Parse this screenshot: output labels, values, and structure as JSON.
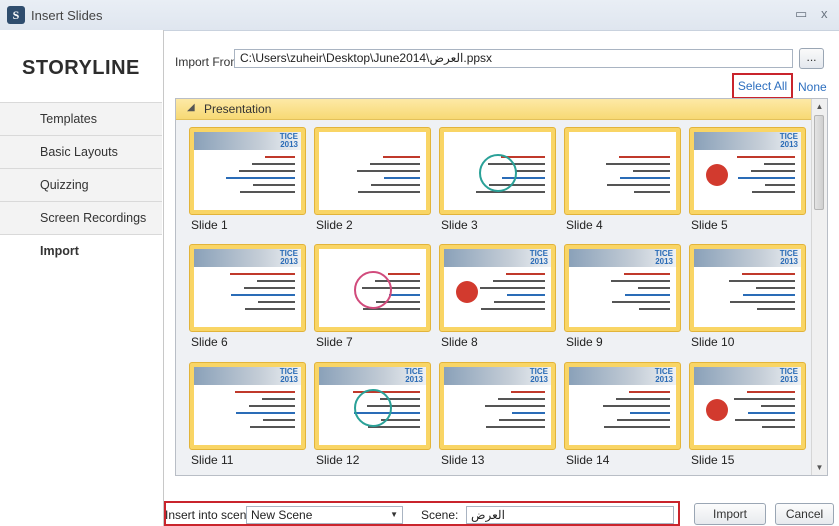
{
  "window": {
    "title": "Insert Slides",
    "minimize_glyph": "▭",
    "close_glyph": "x"
  },
  "sidebar": {
    "brand": "STORYLINE",
    "items": [
      {
        "label": "Templates"
      },
      {
        "label": "Basic Layouts"
      },
      {
        "label": "Quizzing"
      },
      {
        "label": "Screen Recordings"
      },
      {
        "label": "Import",
        "active": true
      }
    ]
  },
  "import_from": {
    "label": "Import From:",
    "path": "C:\\Users\\zuheir\\Desktop\\June2014\\العرض.ppsx",
    "browse_label": "..."
  },
  "selection": {
    "select_all": "Select All",
    "none": "None"
  },
  "gallery": {
    "group_label": "Presentation",
    "slides": [
      {
        "label": "Slide 1"
      },
      {
        "label": "Slide 2"
      },
      {
        "label": "Slide 3"
      },
      {
        "label": "Slide 4"
      },
      {
        "label": "Slide 5"
      },
      {
        "label": "Slide 6"
      },
      {
        "label": "Slide 7"
      },
      {
        "label": "Slide 8"
      },
      {
        "label": "Slide 9"
      },
      {
        "label": "Slide 10"
      },
      {
        "label": "Slide 11"
      },
      {
        "label": "Slide 12"
      },
      {
        "label": "Slide 13"
      },
      {
        "label": "Slide 14"
      },
      {
        "label": "Slide 15"
      }
    ],
    "thumb_tag": "TICE\n2013"
  },
  "footer": {
    "insert_label": "Insert into scene:",
    "insert_value": "New Scene",
    "scene_label": "Scene:",
    "scene_value": "العرض",
    "import_button": "Import",
    "cancel_button": "Cancel"
  },
  "colors": {
    "accent_red": "#c9242c",
    "link_blue": "#2d6fbf",
    "frame_gold": "#f9d565"
  }
}
